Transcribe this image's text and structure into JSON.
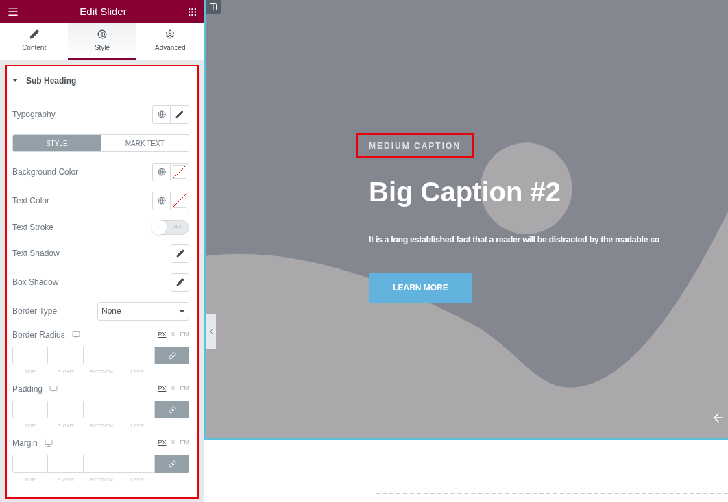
{
  "header": {
    "title": "Edit Slider"
  },
  "tabs": [
    {
      "label": "Content",
      "selected": false
    },
    {
      "label": "Style",
      "selected": true
    },
    {
      "label": "Advanced",
      "selected": false
    }
  ],
  "section": {
    "title": "Sub Heading",
    "expanded": true,
    "highlighted": true
  },
  "controls": [
    {
      "kind": "global_edit",
      "label": "Typography"
    },
    {
      "kind": "switcher",
      "options": [
        {
          "label": "STYLE",
          "selected": true
        },
        {
          "label": "MARK TEXT",
          "selected": false
        }
      ]
    },
    {
      "kind": "color",
      "label": "Background Color"
    },
    {
      "kind": "color",
      "label": "Text Color"
    },
    {
      "kind": "toggle",
      "label": "Text Stroke",
      "on": false,
      "state_label": "NO"
    },
    {
      "kind": "edit",
      "label": "Text Shadow"
    },
    {
      "kind": "edit",
      "label": "Box Shadow"
    },
    {
      "kind": "select",
      "label": "Border Type",
      "value": "None"
    },
    {
      "kind": "dimensions",
      "label": "Border Radius",
      "units": [
        {
          "label": "PX",
          "selected": true
        },
        {
          "label": "%",
          "selected": false
        },
        {
          "label": "EM",
          "selected": false
        }
      ],
      "sides": [
        "TOP",
        "RIGHT",
        "BOTTOM",
        "LEFT"
      ],
      "linked": true
    },
    {
      "kind": "dimensions",
      "label": "Padding",
      "units": [
        {
          "label": "PX",
          "selected": true
        },
        {
          "label": "%",
          "selected": false
        },
        {
          "label": "EM",
          "selected": false
        }
      ],
      "sides": [
        "TOP",
        "RIGHT",
        "BOTTOM",
        "LEFT"
      ],
      "linked": true
    },
    {
      "kind": "dimensions",
      "label": "Margin",
      "units": [
        {
          "label": "PX",
          "selected": true
        },
        {
          "label": "%",
          "selected": false
        },
        {
          "label": "EM",
          "selected": false
        }
      ],
      "sides": [
        "TOP",
        "RIGHT",
        "BOTTOM",
        "LEFT"
      ],
      "linked": true
    }
  ],
  "slide": {
    "caption": "MEDIUM CAPTION",
    "caption_highlighted": true,
    "title": "Big Caption #2",
    "text": "It is a long established fact that a reader will be distracted by the readable co",
    "button": "LEARN MORE"
  }
}
